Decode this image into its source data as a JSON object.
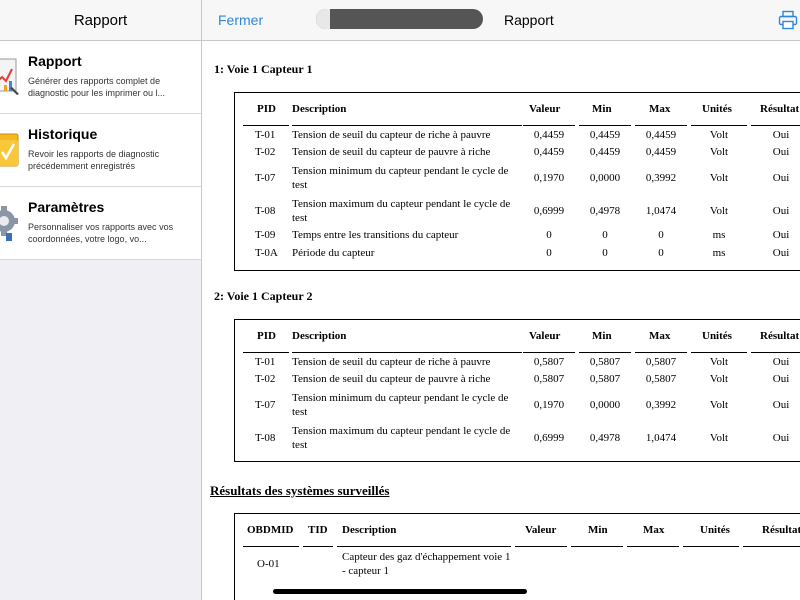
{
  "sidebar": {
    "title": "Rapport",
    "items": [
      {
        "label": "Rapport",
        "desc": "Générer des rapports complet de diagnostic pour les imprimer ou l..."
      },
      {
        "label": "Historique",
        "desc": "Revoir les rapports de diagnostic précédemment enregistrés"
      },
      {
        "label": "Paramètres",
        "desc": "Personnaliser vos rapports avec vos coordonnées, votre logo, vo..."
      }
    ]
  },
  "topbar": {
    "close_label": "Fermer",
    "title": "Rapport"
  },
  "headers": {
    "pid": "PID",
    "description": "Description",
    "valeur": "Valeur",
    "min": "Min",
    "max": "Max",
    "unites": "Unités",
    "resultat": "Résultat",
    "obdmid": "OBDMID",
    "tid": "TID"
  },
  "sections": [
    {
      "title": "1: Voie 1 Capteur 1",
      "rows": [
        {
          "pid": "T-01",
          "desc": "Tension de seuil du capteur de riche à pauvre",
          "valeur": "0,4459",
          "min": "0,4459",
          "max": "0,4459",
          "unites": "Volt",
          "resultat": "Oui"
        },
        {
          "pid": "T-02",
          "desc": "Tension de seuil du capteur de pauvre à riche",
          "valeur": "0,4459",
          "min": "0,4459",
          "max": "0,4459",
          "unites": "Volt",
          "resultat": "Oui"
        },
        {
          "pid": "T-07",
          "desc": "Tension minimum du capteur pendant le cycle de test",
          "valeur": "0,1970",
          "min": "0,0000",
          "max": "0,3992",
          "unites": "Volt",
          "resultat": "Oui"
        },
        {
          "pid": "T-08",
          "desc": "Tension maximum du capteur pendant le cycle de test",
          "valeur": "0,6999",
          "min": "0,4978",
          "max": "1,0474",
          "unites": "Volt",
          "resultat": "Oui"
        },
        {
          "pid": "T-09",
          "desc": "Temps entre les transitions du capteur",
          "valeur": "0",
          "min": "0",
          "max": "0",
          "unites": "ms",
          "resultat": "Oui"
        },
        {
          "pid": "T-0A",
          "desc": "Période du capteur",
          "valeur": "0",
          "min": "0",
          "max": "0",
          "unites": "ms",
          "resultat": "Oui"
        }
      ]
    },
    {
      "title": "2: Voie 1 Capteur 2",
      "rows": [
        {
          "pid": "T-01",
          "desc": "Tension de seuil du capteur de riche à pauvre",
          "valeur": "0,5807",
          "min": "0,5807",
          "max": "0,5807",
          "unites": "Volt",
          "resultat": "Oui"
        },
        {
          "pid": "T-02",
          "desc": "Tension de seuil du capteur de pauvre à riche",
          "valeur": "0,5807",
          "min": "0,5807",
          "max": "0,5807",
          "unites": "Volt",
          "resultat": "Oui"
        },
        {
          "pid": "T-07",
          "desc": "Tension minimum du capteur pendant le cycle de test",
          "valeur": "0,1970",
          "min": "0,0000",
          "max": "0,3992",
          "unites": "Volt",
          "resultat": "Oui"
        },
        {
          "pid": "T-08",
          "desc": "Tension maximum du capteur pendant le cycle de test",
          "valeur": "0,6999",
          "min": "0,4978",
          "max": "1,0474",
          "unites": "Volt",
          "resultat": "Oui"
        }
      ]
    }
  ],
  "monitored": {
    "title": "Résultats des systèmes surveillés",
    "rows": [
      {
        "obdmid": "O-01",
        "desc": "Capteur des gaz d'échappement voie 1 - capteur 1"
      }
    ]
  },
  "colors": {
    "accent": "#2f87d9",
    "sidebar_bg": "#efeff4"
  }
}
